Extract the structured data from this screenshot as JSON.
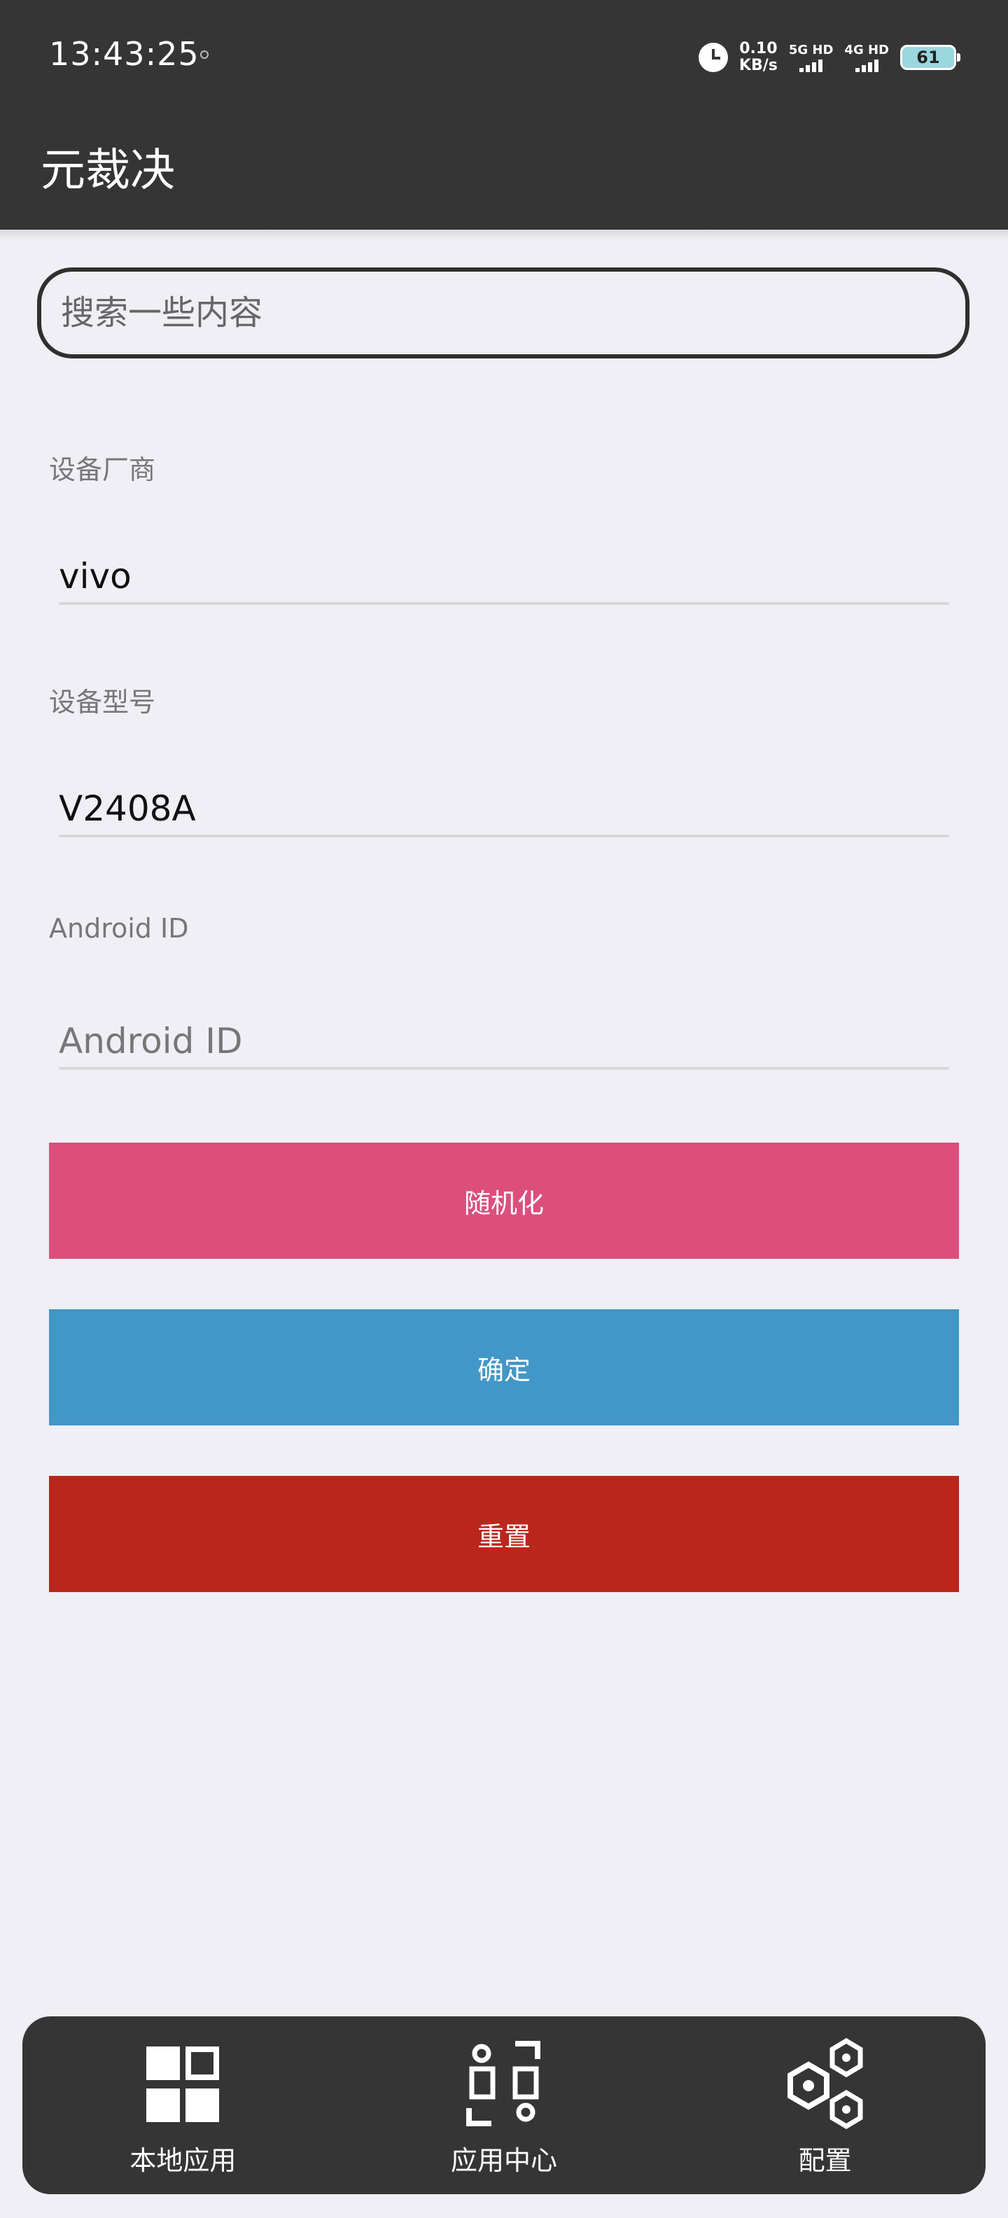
{
  "status": {
    "time": "13:43:25",
    "speed_value": "0.10",
    "speed_unit": "KB/s",
    "sim1": "5G HD",
    "sim2": "4G HD",
    "battery": "61"
  },
  "app": {
    "title": "元裁决"
  },
  "search": {
    "placeholder": "搜索一些内容"
  },
  "fields": [
    {
      "label": "设备厂商",
      "value": "vivo",
      "placeholder": ""
    },
    {
      "label": "设备型号",
      "value": "V2408A",
      "placeholder": ""
    },
    {
      "label": "Android ID",
      "value": "",
      "placeholder": "Android ID"
    }
  ],
  "buttons": {
    "randomize": {
      "label": "随机化",
      "color": "#dc4f7c"
    },
    "confirm": {
      "label": "确定",
      "color": "#4297c8"
    },
    "reset": {
      "label": "重置",
      "color": "#bb261c"
    }
  },
  "nav": [
    {
      "label": "本地应用",
      "icon": "grid-icon"
    },
    {
      "label": "应用中心",
      "icon": "app-center-icon"
    },
    {
      "label": "配置",
      "icon": "hexagon-config-icon"
    }
  ]
}
